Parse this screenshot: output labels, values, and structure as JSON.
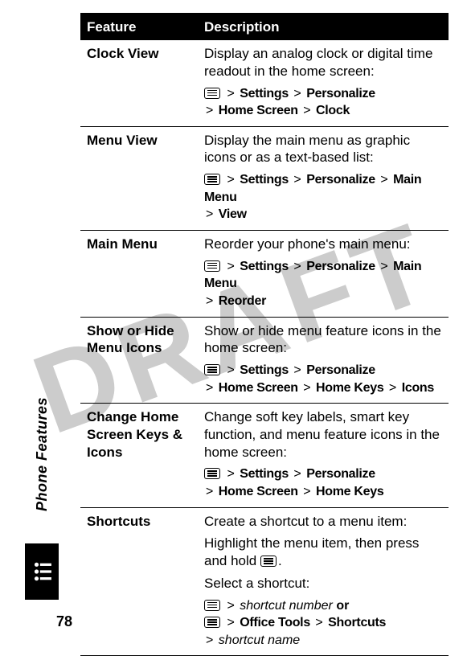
{
  "watermark": "DRAFT",
  "page_number": "78",
  "section_title": "Phone Features",
  "table": {
    "headers": {
      "feature": "Feature",
      "description": "Description"
    },
    "rows": [
      {
        "feature": "Clock View",
        "desc": "Display an analog clock or digital time readout in the home screen:",
        "path_parts": [
          "Settings",
          "Personalize",
          "Home Screen",
          "Clock"
        ]
      },
      {
        "feature": "Menu View",
        "desc": "Display the main menu as graphic icons or as a text-based list:",
        "path_parts": [
          "Settings",
          "Personalize",
          "Main Menu",
          "View"
        ]
      },
      {
        "feature": "Main Menu",
        "desc": "Reorder your phone's main menu:",
        "path_parts": [
          "Settings",
          "Personalize",
          "Main Menu",
          "Reorder"
        ]
      },
      {
        "feature": "Show or Hide Menu Icons",
        "desc": "Show or hide menu feature icons in the home screen:",
        "path_parts": [
          "Settings",
          "Personalize",
          "Home Screen",
          "Home Keys",
          "Icons"
        ]
      },
      {
        "feature": "Change Home Screen Keys & Icons",
        "desc": "Change soft key labels, smart key function, and menu feature icons in the home screen:",
        "path_parts": [
          "Settings",
          "Personalize",
          "Home Screen",
          "Home Keys"
        ]
      },
      {
        "feature": "Shortcuts",
        "desc": "Create a shortcut to a menu item:",
        "extra1": "Highlight the menu item, then press and hold ",
        "extra1_tail": ".",
        "extra2": "Select a shortcut:",
        "alt_path1_italic": "shortcut number",
        "alt_or": "or",
        "alt_path2_parts": [
          "Office Tools",
          "Shortcuts"
        ],
        "alt_path2_tail_italic": "shortcut name"
      }
    ]
  }
}
